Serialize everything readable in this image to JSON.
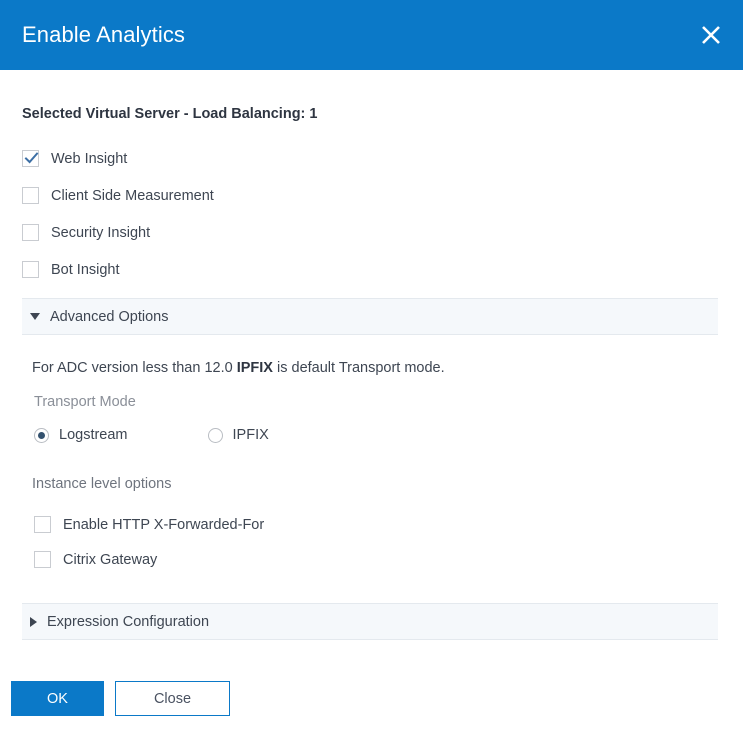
{
  "dialog": {
    "title": "Enable Analytics",
    "close_icon": "close-icon",
    "accent_color": "#0b79c8",
    "header_text_color": "#ffffff",
    "body_text_color": "#3e4652",
    "accordion_bg_color": "#f5f8fb"
  },
  "section": {
    "heading": "Selected Virtual Server - Load Balancing: 1"
  },
  "insight_options": [
    {
      "label": "Web Insight",
      "checked": true
    },
    {
      "label": "Client Side Measurement",
      "checked": false
    },
    {
      "label": "Security Insight",
      "checked": false
    },
    {
      "label": "Bot Insight",
      "checked": false
    }
  ],
  "advanced": {
    "bar_label": "Advanced Options",
    "expanded": true,
    "toggle_icon": "chevron-down-icon",
    "note_prefix": "For ADC version less than 12.0 ",
    "note_bold": "IPFIX",
    "note_suffix": " is default Transport mode.",
    "transport_mode_label": "Transport Mode",
    "transport_modes": [
      {
        "label": "Logstream",
        "selected": true
      },
      {
        "label": "IPFIX",
        "selected": false
      }
    ],
    "instance_options_label": "Instance level options",
    "instance_options": [
      {
        "label": "Enable HTTP X-Forwarded-For",
        "checked": false
      },
      {
        "label": "Citrix Gateway",
        "checked": false
      }
    ]
  },
  "expression": {
    "bar_label": "Expression Configuration",
    "expanded": false,
    "toggle_icon": "chevron-right-icon"
  },
  "footer": {
    "ok_label": "OK",
    "close_label": "Close"
  }
}
